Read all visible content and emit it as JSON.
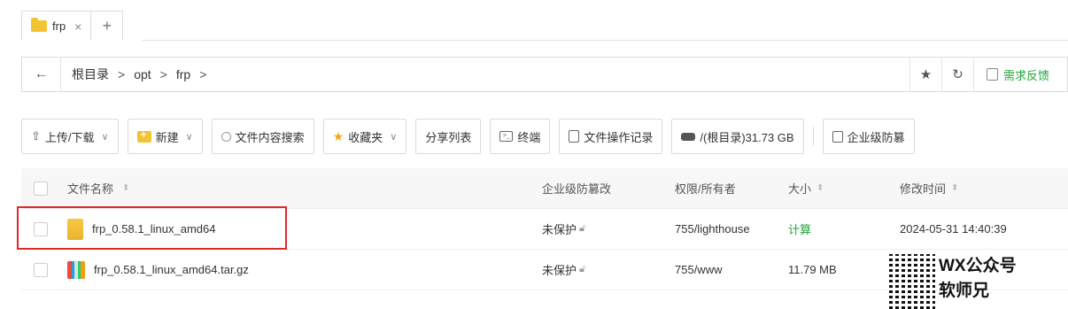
{
  "tab": {
    "label": "frp",
    "close": "×",
    "add": "+"
  },
  "address": {
    "back": "←",
    "crumbs": [
      "根目录",
      "opt",
      "frp"
    ],
    "sep": ">",
    "feedback": "需求反馈"
  },
  "toolbar": {
    "upload": "上传/下载",
    "new": "新建",
    "search": "文件内容搜索",
    "favorites": "收藏夹",
    "share": "分享列表",
    "terminal": "终端",
    "oplog": "文件操作记录",
    "disk": "/(根目录)31.73 GB",
    "antitamper": "企业级防篡"
  },
  "table": {
    "headers": {
      "name": "文件名称",
      "protect": "企业级防篡改",
      "perm": "权限/所有者",
      "size": "大小",
      "modified": "修改时间"
    },
    "rows": [
      {
        "name": "frp_0.58.1_linux_amd64",
        "type": "folder",
        "protect": "未保护",
        "perm": "755/lighthouse",
        "size": "计算",
        "modified": "2024-05-31 14:40:39"
      },
      {
        "name": "frp_0.58.1_linux_amd64.tar.gz",
        "type": "archive",
        "protect": "未保护",
        "perm": "755/www",
        "size": "11.79 MB",
        "modified": ""
      }
    ]
  },
  "watermark": {
    "line1": "WX公众号",
    "line2": "软师兄"
  },
  "colors": {
    "accent": "#20a53a",
    "highlight": "#e02a2a",
    "folder": "#f3c431"
  }
}
